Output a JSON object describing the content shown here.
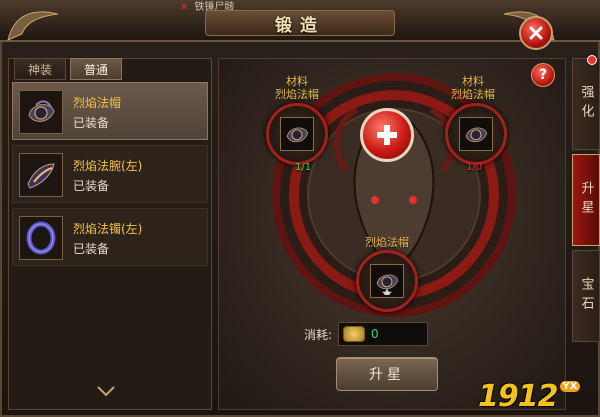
{
  "header": {
    "notice": "铁锤尸骸",
    "title": "锻造"
  },
  "left_tabs": [
    {
      "label": "神装",
      "active": false
    },
    {
      "label": "普通",
      "active": true
    }
  ],
  "items": [
    {
      "name": "烈焰法帽",
      "status": "已装备",
      "selected": true,
      "icon": "hat-icon"
    },
    {
      "name": "烈焰法腕(左)",
      "status": "已装备",
      "selected": false,
      "icon": "bracer-icon"
    },
    {
      "name": "烈焰法镯(左)",
      "status": "已装备",
      "selected": false,
      "icon": "bracelet-icon"
    }
  ],
  "forge": {
    "material_left": {
      "title": "材料",
      "name": "烈焰法帽",
      "count": "1/1",
      "count_color": "#3fd36b"
    },
    "material_right": {
      "title": "材料",
      "name": "烈焰法帽",
      "count": "1/0",
      "count_color": "#e33333"
    },
    "result": {
      "name": "烈焰法帽"
    },
    "cost_label": "消耗:",
    "cost_value": "0",
    "upgrade_label": "升星",
    "help_label": "?"
  },
  "right_tabs": [
    {
      "label": "强化",
      "active": false,
      "badge": true
    },
    {
      "label": "升星",
      "active": true,
      "badge": false
    },
    {
      "label": "宝石",
      "active": false,
      "badge": false
    }
  ],
  "watermark": {
    "number": "1912",
    "badge": "YX"
  },
  "colors": {
    "accent_red": "#b3150f",
    "gold_text": "#f0c24a",
    "green_text": "#3fd36b"
  }
}
